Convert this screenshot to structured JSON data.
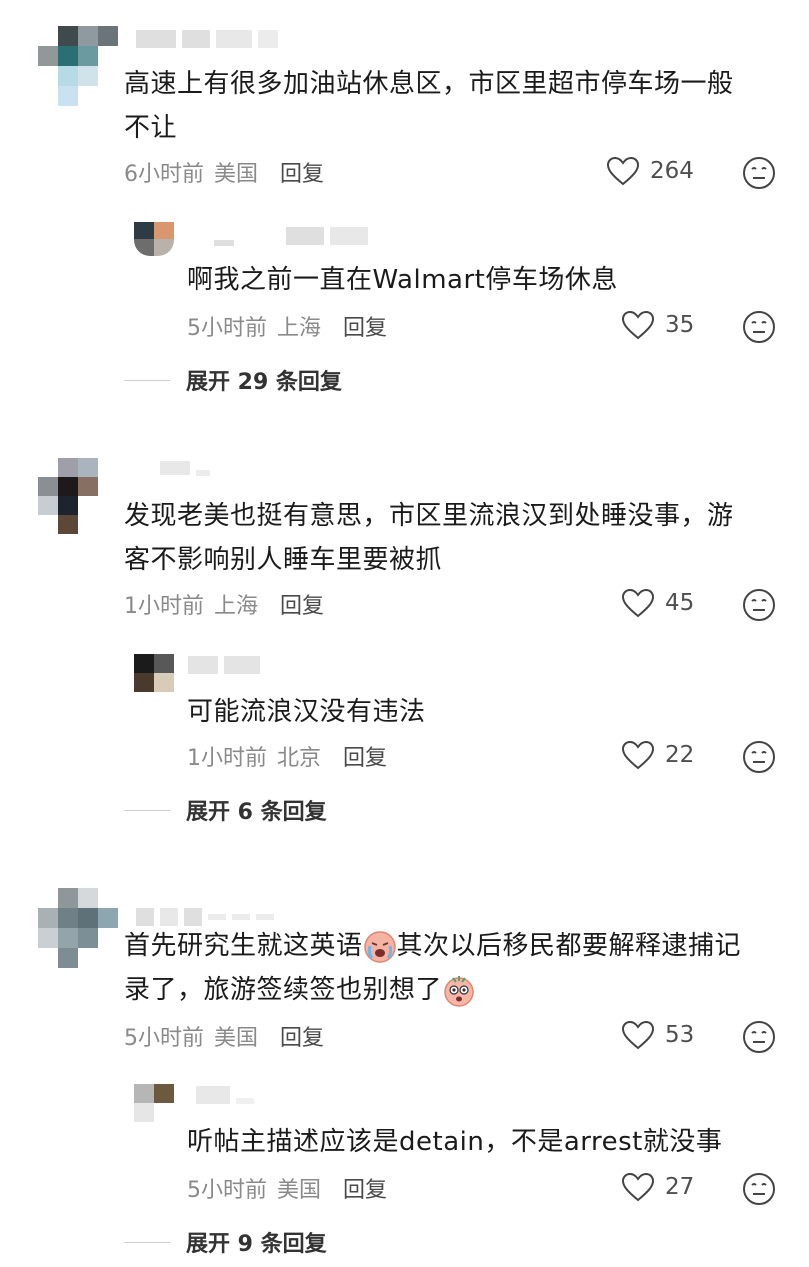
{
  "threads": [
    {
      "comment": {
        "text_lines": [
          "高速上有很多加油站休息区，市区里超市停车场一般",
          "不让"
        ],
        "time": "6小时前",
        "location": "美国",
        "reply_label": "回复",
        "likes": "264"
      },
      "reply": {
        "text": "啊我之前一直在Walmart停车场休息",
        "time": "5小时前",
        "location": "上海",
        "reply_label": "回复",
        "likes": "35"
      },
      "expand_label": "展开 29 条回复"
    },
    {
      "comment": {
        "text_lines": [
          "发现老美也挺有意思，市区里流浪汉到处睡没事，游",
          "客不影响别人睡车里要被抓"
        ],
        "time": "1小时前",
        "location": "上海",
        "reply_label": "回复",
        "likes": "45"
      },
      "reply": {
        "text": "可能流浪汉没有违法",
        "time": "1小时前",
        "location": "北京",
        "reply_label": "回复",
        "likes": "22"
      },
      "expand_label": "展开 6 条回复"
    },
    {
      "comment": {
        "line1_a": "首先研究生就这英语",
        "line1_b": "其次以后移民都要解释逮捕记",
        "line2": "录了，旅游签续签也别想了",
        "emoji_1": "crying-face-emoji",
        "emoji_2": "shocked-face-emoji",
        "time": "5小时前",
        "location": "美国",
        "reply_label": "回复",
        "likes": "53"
      },
      "reply": {
        "text": "听帖主描述应该是detain，不是arrest就没事",
        "time": "5小时前",
        "location": "美国",
        "reply_label": "回复",
        "likes": "27"
      },
      "expand_label": "展开 9 条回复"
    }
  ],
  "icons": {
    "like": "heart-outline-icon",
    "reaction": "meh-face-icon"
  },
  "colors": {
    "text": "#1b1b1b",
    "meta": "#8a8a8a",
    "reply": "#4a4a4a"
  }
}
